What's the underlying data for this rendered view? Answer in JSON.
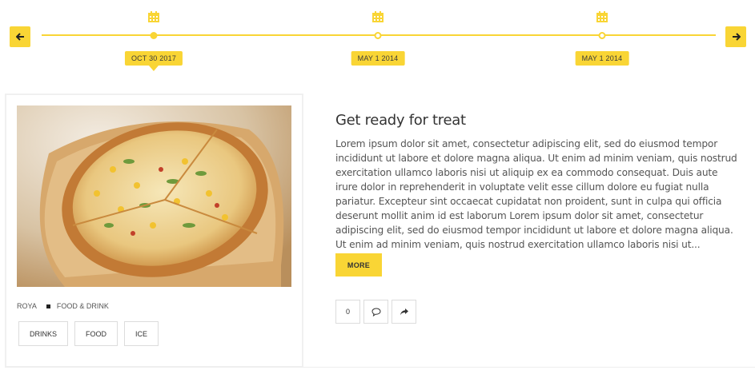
{
  "timeline": {
    "prev_icon": "arrow-left-icon",
    "next_icon": "arrow-right-icon",
    "points": [
      {
        "date": "OCT 30 2017",
        "active": true
      },
      {
        "date": "MAY 1 2014",
        "active": false
      },
      {
        "date": "MAY 1 2014",
        "active": false
      }
    ]
  },
  "post": {
    "author": "ROYA",
    "category": "FOOD & DRINK",
    "tags": [
      "DRINKS",
      "FOOD",
      "ICE"
    ],
    "title": "Get ready for treat",
    "excerpt": "Lorem ipsum dolor sit amet, consectetur adipiscing elit, sed do eiusmod tempor incididunt ut labore et dolore magna aliqua. Ut enim ad minim veniam, quis nostrud exercitation ullamco laboris nisi ut aliquip ex ea commodo consequat. Duis aute irure dolor in reprehenderit in voluptate velit esse cillum dolore eu fugiat nulla pariatur. Excepteur sint occaecat cupidatat non proident, sunt in culpa qui officia deserunt mollit anim id est laborum Lorem ipsum dolor sit amet, consectetur adipiscing elit, sed do eiusmod tempor incididunt ut labore et dolore magna aliqua. Ut enim ad minim veniam, quis nostrud exercitation ullamco laboris nisi ut...",
    "more_label": "MORE",
    "like_count": "0",
    "comment_icon": "comment-icon",
    "share_icon": "share-icon"
  },
  "colors": {
    "accent": "#f9d535"
  }
}
